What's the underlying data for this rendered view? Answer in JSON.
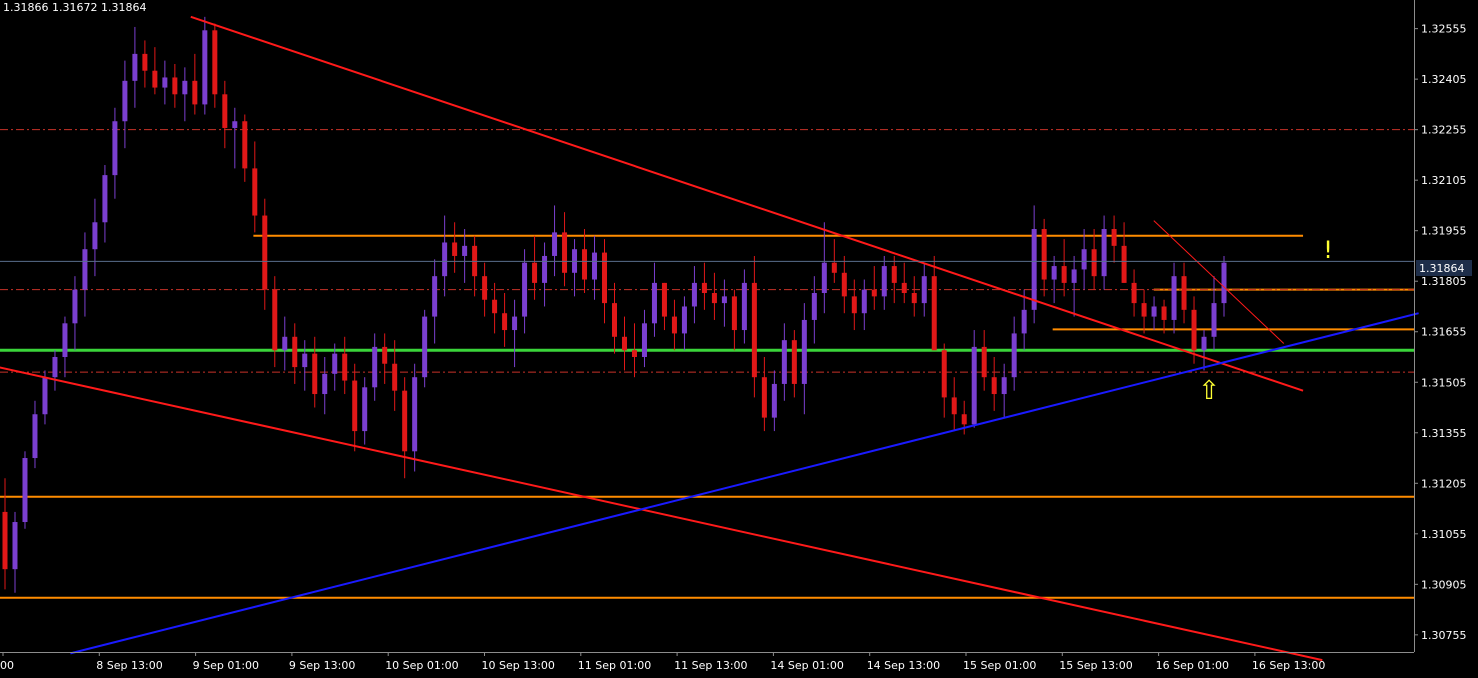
{
  "ohlc_header": "1.31866 1.31672 1.31864",
  "current_price_label": "1.31864",
  "annotations": {
    "exclamation": "!",
    "up_arrow": "⇧"
  },
  "colors": {
    "background": "#000000",
    "bull_candle": "#7b3fd0",
    "bear_candle": "#e01818",
    "axis_text": "#ffffff",
    "axis_line": "#8c8c8c",
    "current_price_line": "#5a6e8c",
    "current_price_box": "#1e2e4a",
    "horizontal_level": "#ff8c00",
    "dashdot_level": "#c83228",
    "green_level": "#3ad43a",
    "red_trendline": "#ff1a1a",
    "blue_trendline": "#1a1aff",
    "annotation_yellow": "#ffff33"
  },
  "chart_data": {
    "type": "candlestick",
    "y_ticks": [
      "1.32555",
      "1.32405",
      "1.32255",
      "1.32105",
      "1.31955",
      "1.31805",
      "1.31655",
      "1.31505",
      "1.31355",
      "1.31205",
      "1.31055",
      "1.30905",
      "1.30755"
    ],
    "ylim": [
      1.3071,
      1.3264
    ],
    "x_ticks": [
      "00",
      "8 Sep 13:00",
      "9 Sep 01:00",
      "9 Sep 13:00",
      "10 Sep 01:00",
      "10 Sep 13:00",
      "11 Sep 01:00",
      "11 Sep 13:00",
      "14 Sep 01:00",
      "14 Sep 13:00",
      "15 Sep 01:00",
      "15 Sep 13:00",
      "16 Sep 01:00",
      "16 Sep 13:00"
    ],
    "current_price": 1.31864,
    "horizontal_levels": [
      {
        "style": "solid",
        "color": "orange",
        "price": 1.3194,
        "from_tick": 2.6,
        "to_tick": 13.5
      },
      {
        "style": "solid",
        "color": "orange",
        "price": 1.3178,
        "from_tick": 11.95,
        "to_tick": "edge"
      },
      {
        "style": "solid",
        "color": "orange",
        "price": 1.31662,
        "from_tick": 10.9,
        "to_tick": "edge"
      },
      {
        "style": "solid",
        "color": "green",
        "price": 1.316,
        "from_tick": "edge",
        "to_tick": "edge"
      },
      {
        "style": "solid",
        "color": "orange",
        "price": 1.31165,
        "from_tick": "edge",
        "to_tick": "edge"
      },
      {
        "style": "solid",
        "color": "orange",
        "price": 1.30865,
        "from_tick": "edge",
        "to_tick": "edge"
      },
      {
        "style": "dashdot",
        "color": "red",
        "price": 1.32255,
        "from_tick": "edge",
        "to_tick": "edge"
      },
      {
        "style": "dashdot",
        "color": "red",
        "price": 1.3178,
        "from_tick": "edge",
        "to_tick": "edge"
      },
      {
        "style": "dashdot",
        "color": "red",
        "price": 1.31535,
        "from_tick": "edge",
        "to_tick": "edge"
      }
    ],
    "trendlines": [
      {
        "color": "red",
        "from": [
          1.95,
          1.3259
        ],
        "to": [
          13.5,
          1.3148
        ]
      },
      {
        "color": "red",
        "from": [
          -0.05,
          1.3155
        ],
        "to": [
          13.7,
          1.3068
        ]
      },
      {
        "color": "blue",
        "from": [
          0.7,
          1.307
        ],
        "to": [
          14.7,
          1.3171
        ]
      },
      {
        "color": "red_thin",
        "from": [
          11.95,
          1.31985
        ],
        "to": [
          13.3,
          1.3162
        ]
      }
    ],
    "candles": [
      [
        1.3112,
        1.3122,
        1.3089,
        1.3095
      ],
      [
        1.3095,
        1.3112,
        1.3088,
        1.3109
      ],
      [
        1.3109,
        1.313,
        1.3107,
        1.3128
      ],
      [
        1.3128,
        1.3145,
        1.3125,
        1.3141
      ],
      [
        1.3141,
        1.3154,
        1.3138,
        1.3152
      ],
      [
        1.3152,
        1.316,
        1.3148,
        1.3158
      ],
      [
        1.3158,
        1.317,
        1.3152,
        1.3168
      ],
      [
        1.3168,
        1.3182,
        1.316,
        1.3178
      ],
      [
        1.3178,
        1.3195,
        1.317,
        1.319
      ],
      [
        1.319,
        1.3205,
        1.3182,
        1.3198
      ],
      [
        1.3198,
        1.3215,
        1.3192,
        1.3212
      ],
      [
        1.3212,
        1.3232,
        1.3205,
        1.3228
      ],
      [
        1.3228,
        1.3246,
        1.322,
        1.324
      ],
      [
        1.324,
        1.3256,
        1.3232,
        1.3248
      ],
      [
        1.3248,
        1.3252,
        1.3238,
        1.3243
      ],
      [
        1.3243,
        1.325,
        1.3236,
        1.3238
      ],
      [
        1.3238,
        1.3246,
        1.3233,
        1.3241
      ],
      [
        1.3241,
        1.3245,
        1.3232,
        1.3236
      ],
      [
        1.3236,
        1.3244,
        1.3228,
        1.324
      ],
      [
        1.324,
        1.3248,
        1.323,
        1.3233
      ],
      [
        1.3233,
        1.3259,
        1.323,
        1.3255
      ],
      [
        1.3255,
        1.3257,
        1.3232,
        1.3236
      ],
      [
        1.3236,
        1.324,
        1.322,
        1.3226
      ],
      [
        1.3226,
        1.3232,
        1.3214,
        1.3228
      ],
      [
        1.3228,
        1.323,
        1.321,
        1.3214
      ],
      [
        1.3214,
        1.3222,
        1.3195,
        1.32
      ],
      [
        1.32,
        1.3205,
        1.3172,
        1.3178
      ],
      [
        1.3178,
        1.3182,
        1.3155,
        1.316
      ],
      [
        1.316,
        1.317,
        1.3154,
        1.3164
      ],
      [
        1.3164,
        1.3168,
        1.315,
        1.3155
      ],
      [
        1.3155,
        1.3163,
        1.3148,
        1.3159
      ],
      [
        1.3159,
        1.3164,
        1.3143,
        1.3147
      ],
      [
        1.3147,
        1.3158,
        1.3141,
        1.3153
      ],
      [
        1.3153,
        1.3162,
        1.3148,
        1.3159
      ],
      [
        1.3159,
        1.3164,
        1.3147,
        1.3151
      ],
      [
        1.3151,
        1.3156,
        1.313,
        1.3136
      ],
      [
        1.3136,
        1.3152,
        1.3132,
        1.3149
      ],
      [
        1.3149,
        1.3165,
        1.3145,
        1.3161
      ],
      [
        1.3161,
        1.3165,
        1.315,
        1.3156
      ],
      [
        1.3156,
        1.3163,
        1.3142,
        1.3148
      ],
      [
        1.3148,
        1.3152,
        1.3122,
        1.313
      ],
      [
        1.313,
        1.3156,
        1.3124,
        1.3152
      ],
      [
        1.3152,
        1.3172,
        1.3149,
        1.317
      ],
      [
        1.317,
        1.3187,
        1.3162,
        1.3182
      ],
      [
        1.3182,
        1.32,
        1.3176,
        1.3192
      ],
      [
        1.3192,
        1.3198,
        1.3183,
        1.3188
      ],
      [
        1.3188,
        1.3196,
        1.318,
        1.3191
      ],
      [
        1.3191,
        1.3194,
        1.3176,
        1.3182
      ],
      [
        1.3182,
        1.3186,
        1.317,
        1.3175
      ],
      [
        1.3175,
        1.318,
        1.3165,
        1.3171
      ],
      [
        1.3171,
        1.3177,
        1.3161,
        1.3166
      ],
      [
        1.3166,
        1.3175,
        1.3155,
        1.317
      ],
      [
        1.317,
        1.319,
        1.3165,
        1.3186
      ],
      [
        1.3186,
        1.3194,
        1.3175,
        1.318
      ],
      [
        1.318,
        1.3192,
        1.3173,
        1.3188
      ],
      [
        1.3188,
        1.3203,
        1.3182,
        1.3195
      ],
      [
        1.3195,
        1.3201,
        1.3179,
        1.3183
      ],
      [
        1.3183,
        1.3193,
        1.3176,
        1.319
      ],
      [
        1.319,
        1.3196,
        1.3177,
        1.3181
      ],
      [
        1.3181,
        1.3194,
        1.3175,
        1.3189
      ],
      [
        1.3189,
        1.3193,
        1.3168,
        1.3174
      ],
      [
        1.3174,
        1.318,
        1.3159,
        1.3164
      ],
      [
        1.3164,
        1.317,
        1.3154,
        1.316
      ],
      [
        1.316,
        1.3168,
        1.3152,
        1.3158
      ],
      [
        1.3158,
        1.3172,
        1.3155,
        1.3168
      ],
      [
        1.3168,
        1.3186,
        1.3164,
        1.318
      ],
      [
        1.318,
        1.318,
        1.3166,
        1.317
      ],
      [
        1.317,
        1.3175,
        1.316,
        1.3165
      ],
      [
        1.3165,
        1.3176,
        1.316,
        1.3173
      ],
      [
        1.3173,
        1.3185,
        1.3168,
        1.318
      ],
      [
        1.318,
        1.3186,
        1.3172,
        1.3177
      ],
      [
        1.3177,
        1.3183,
        1.3169,
        1.3174
      ],
      [
        1.3174,
        1.3181,
        1.3167,
        1.3176
      ],
      [
        1.3176,
        1.3178,
        1.316,
        1.3166
      ],
      [
        1.3166,
        1.3184,
        1.3162,
        1.318
      ],
      [
        1.318,
        1.3188,
        1.3146,
        1.3152
      ],
      [
        1.3152,
        1.3158,
        1.3136,
        1.314
      ],
      [
        1.314,
        1.3154,
        1.3136,
        1.315
      ],
      [
        1.315,
        1.3168,
        1.3145,
        1.3163
      ],
      [
        1.3163,
        1.3166,
        1.3146,
        1.315
      ],
      [
        1.315,
        1.3174,
        1.3141,
        1.3169
      ],
      [
        1.3169,
        1.3182,
        1.3162,
        1.3177
      ],
      [
        1.3177,
        1.3198,
        1.3171,
        1.3186
      ],
      [
        1.3186,
        1.3193,
        1.318,
        1.3183
      ],
      [
        1.3183,
        1.3188,
        1.3171,
        1.3176
      ],
      [
        1.3176,
        1.3181,
        1.3166,
        1.3171
      ],
      [
        1.3171,
        1.3181,
        1.3166,
        1.3178
      ],
      [
        1.3178,
        1.3185,
        1.3172,
        1.3176
      ],
      [
        1.3176,
        1.3188,
        1.3172,
        1.3185
      ],
      [
        1.3185,
        1.3188,
        1.3174,
        1.318
      ],
      [
        1.318,
        1.3186,
        1.3174,
        1.3177
      ],
      [
        1.3177,
        1.3182,
        1.317,
        1.3174
      ],
      [
        1.3174,
        1.3186,
        1.317,
        1.3182
      ],
      [
        1.3182,
        1.3188,
        1.3164,
        1.316
      ],
      [
        1.316,
        1.3162,
        1.314,
        1.3146
      ],
      [
        1.3146,
        1.3152,
        1.3136,
        1.3141
      ],
      [
        1.3141,
        1.3145,
        1.3135,
        1.3138
      ],
      [
        1.3138,
        1.3166,
        1.3137,
        1.3161
      ],
      [
        1.3161,
        1.3166,
        1.3148,
        1.3152
      ],
      [
        1.3152,
        1.3158,
        1.3142,
        1.3147
      ],
      [
        1.3147,
        1.3156,
        1.314,
        1.3152
      ],
      [
        1.3152,
        1.317,
        1.3148,
        1.3165
      ],
      [
        1.3165,
        1.3178,
        1.316,
        1.3172
      ],
      [
        1.3172,
        1.3203,
        1.3168,
        1.3196
      ],
      [
        1.3196,
        1.3199,
        1.3176,
        1.3181
      ],
      [
        1.3181,
        1.3188,
        1.3174,
        1.3185
      ],
      [
        1.3185,
        1.3193,
        1.3176,
        1.318
      ],
      [
        1.318,
        1.3188,
        1.317,
        1.3184
      ],
      [
        1.3184,
        1.3196,
        1.3178,
        1.319
      ],
      [
        1.319,
        1.3196,
        1.3178,
        1.3182
      ],
      [
        1.3182,
        1.32,
        1.3178,
        1.3196
      ],
      [
        1.3196,
        1.32,
        1.3186,
        1.3191
      ],
      [
        1.3191,
        1.3198,
        1.318,
        1.318
      ],
      [
        1.318,
        1.3184,
        1.317,
        1.3174
      ],
      [
        1.3174,
        1.3178,
        1.3165,
        1.317
      ],
      [
        1.317,
        1.3176,
        1.3166,
        1.3173
      ],
      [
        1.3173,
        1.3175,
        1.3165,
        1.3169
      ],
      [
        1.3169,
        1.3186,
        1.3165,
        1.3182
      ],
      [
        1.3182,
        1.3186,
        1.3168,
        1.3172
      ],
      [
        1.3172,
        1.3176,
        1.3156,
        1.316
      ],
      [
        1.316,
        1.3166,
        1.3154,
        1.3164
      ],
      [
        1.3164,
        1.3182,
        1.316,
        1.3174
      ],
      [
        1.3174,
        1.3188,
        1.317,
        1.3186
      ]
    ]
  }
}
